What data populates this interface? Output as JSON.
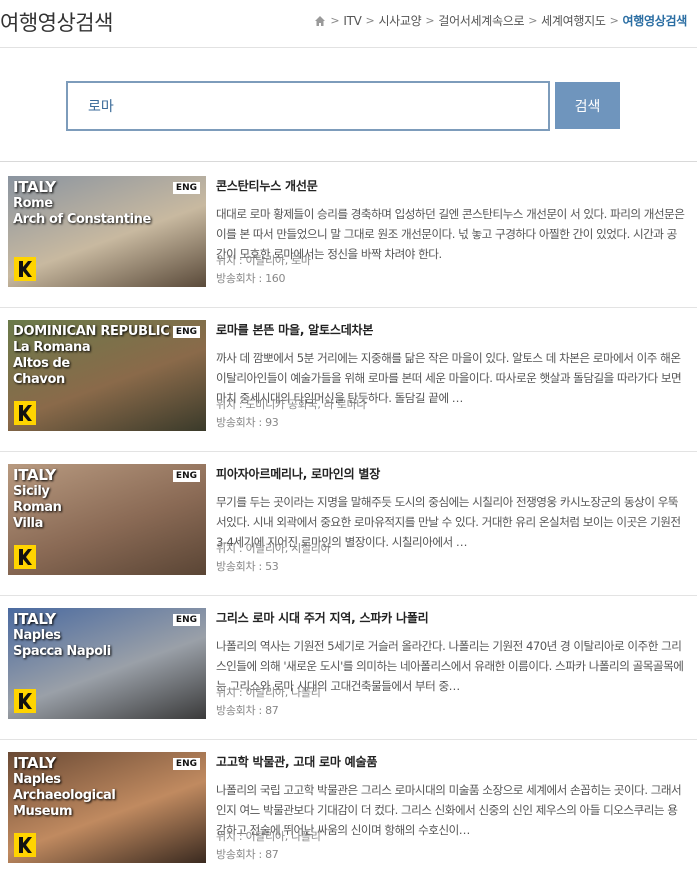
{
  "page_title": "여행영상검색",
  "breadcrumb": {
    "items": [
      "ITV",
      "시사교양",
      "걸어서세계속으로",
      "세계여행지도"
    ],
    "current": "여행영상검색"
  },
  "search": {
    "value": "로마",
    "button_label": "검색"
  },
  "results": [
    {
      "thumb": {
        "country": "ITALY",
        "place": "Rome\nArch of Constantine",
        "lang": "ENG",
        "colors": [
          "#8a94a0",
          "#c8b9a0",
          "#5a4a3a"
        ]
      },
      "title": "콘스탄티누스 개선문",
      "description": "대대로 로마 황제들이 승리를 경축하며 입성하던 길엔 콘스탄티누스 개선문이 서 있다. 파리의 개선문은 이를 본 따서 만들었으니 말 그대로 원조 개선문이다. 넋 놓고 구경하다 아찔한 간이 있었다. 시간과 공간이 모호한 로마에서는 정신을 바짝 차려야 한다.",
      "location": "위치 : 이탈리아, 로마",
      "episode": "방송회차 : 160"
    },
    {
      "thumb": {
        "country": "DOMINICAN REPUBLIC",
        "place": "La Romana\nAltos de\nChavon",
        "lang": "ENG",
        "colors": [
          "#6a7a4a",
          "#8a6a4a",
          "#3a3a2a"
        ]
      },
      "title": "로마를 본뜬 마을, 알토스데차본",
      "description": "까사 데 깜뽀에서 5분 거리에는 지중해를 닮은 작은 마을이 있다. 알토스 데 차본은 로마에서 이주 해온 이탈리아인들이 예술가들을 위해 로마를 본떠 세운 마을이다. 따사로운 햇살과 돌담길을 따라가다 보면 마치 중세시대의 타임머신을 탄듯하다. 돌담길 끝에 …",
      "location": "위치 : 도미니카 공화국, 라 로마나",
      "episode": "방송회차 : 93"
    },
    {
      "thumb": {
        "country": "ITALY",
        "place": "Sicily\nRoman\nVilla",
        "lang": "ENG",
        "colors": [
          "#b89a80",
          "#8a6a55",
          "#5a4535"
        ]
      },
      "title": "피아자아르메리나, 로마인의 별장",
      "description": "무기를 두는 곳이라는 지명을 말해주듯 도시의 중심에는 시칠리아 전쟁영웅 카시노장군의 동상이 우뚝 서있다. 시내 외곽에서 중요한 로마유적지를 만날 수 있다. 거대한 유리 온실처럼 보이는 이곳은 기원전 3-4세기에 지어진 로마인의 별장이다. 시칠리아에서 …",
      "location": "위치 : 이탈리아, 시칠리아",
      "episode": "방송회차 : 53"
    },
    {
      "thumb": {
        "country": "ITALY",
        "place": "Naples\nSpacca Napoli",
        "lang": "ENG",
        "colors": [
          "#4a6aa0",
          "#9aa0a8",
          "#3a3a3a"
        ]
      },
      "title": "그리스 로마 시대 주거 지역, 스파카 나폴리",
      "description": "나폴리의 역사는 기원전 5세기로 거슬러 올라간다. 나폴리는 기원전 470년 경 이탈리아로 이주한 그리스인들에 의해 '새로운 도시'를 의미하는 네아폴리스에서 유래한 이름이다. 스파카 나폴리의 골목골목에는 그리스와 로마 시대의 고대건축물들에서 부터 중…",
      "location": "위치 : 이탈리아, 나폴리",
      "episode": "방송회차 : 87"
    },
    {
      "thumb": {
        "country": "ITALY",
        "place": "Naples\nArchaeological\nMuseum",
        "lang": "ENG",
        "colors": [
          "#6a4a35",
          "#c08a60",
          "#3a2a20"
        ]
      },
      "title": "고고학 박물관, 고대 로마 예술품",
      "description": "나폴리의 국립 고고학 박물관은 그리스 로마시대의 미술품 소장으로 세계에서 손꼽히는 곳이다. 그래서인지 여느 박물관보다 기대감이 더 컸다. 그리스 신화에서 신중의 신인 제우스의 아들 디오스쿠리는 용감하고 전술에 뛰어난 싸움의 신이며 항해의 수호신이…",
      "location": "위치 : 이탈리아, 나폴리",
      "episode": "방송회차 : 87"
    }
  ]
}
